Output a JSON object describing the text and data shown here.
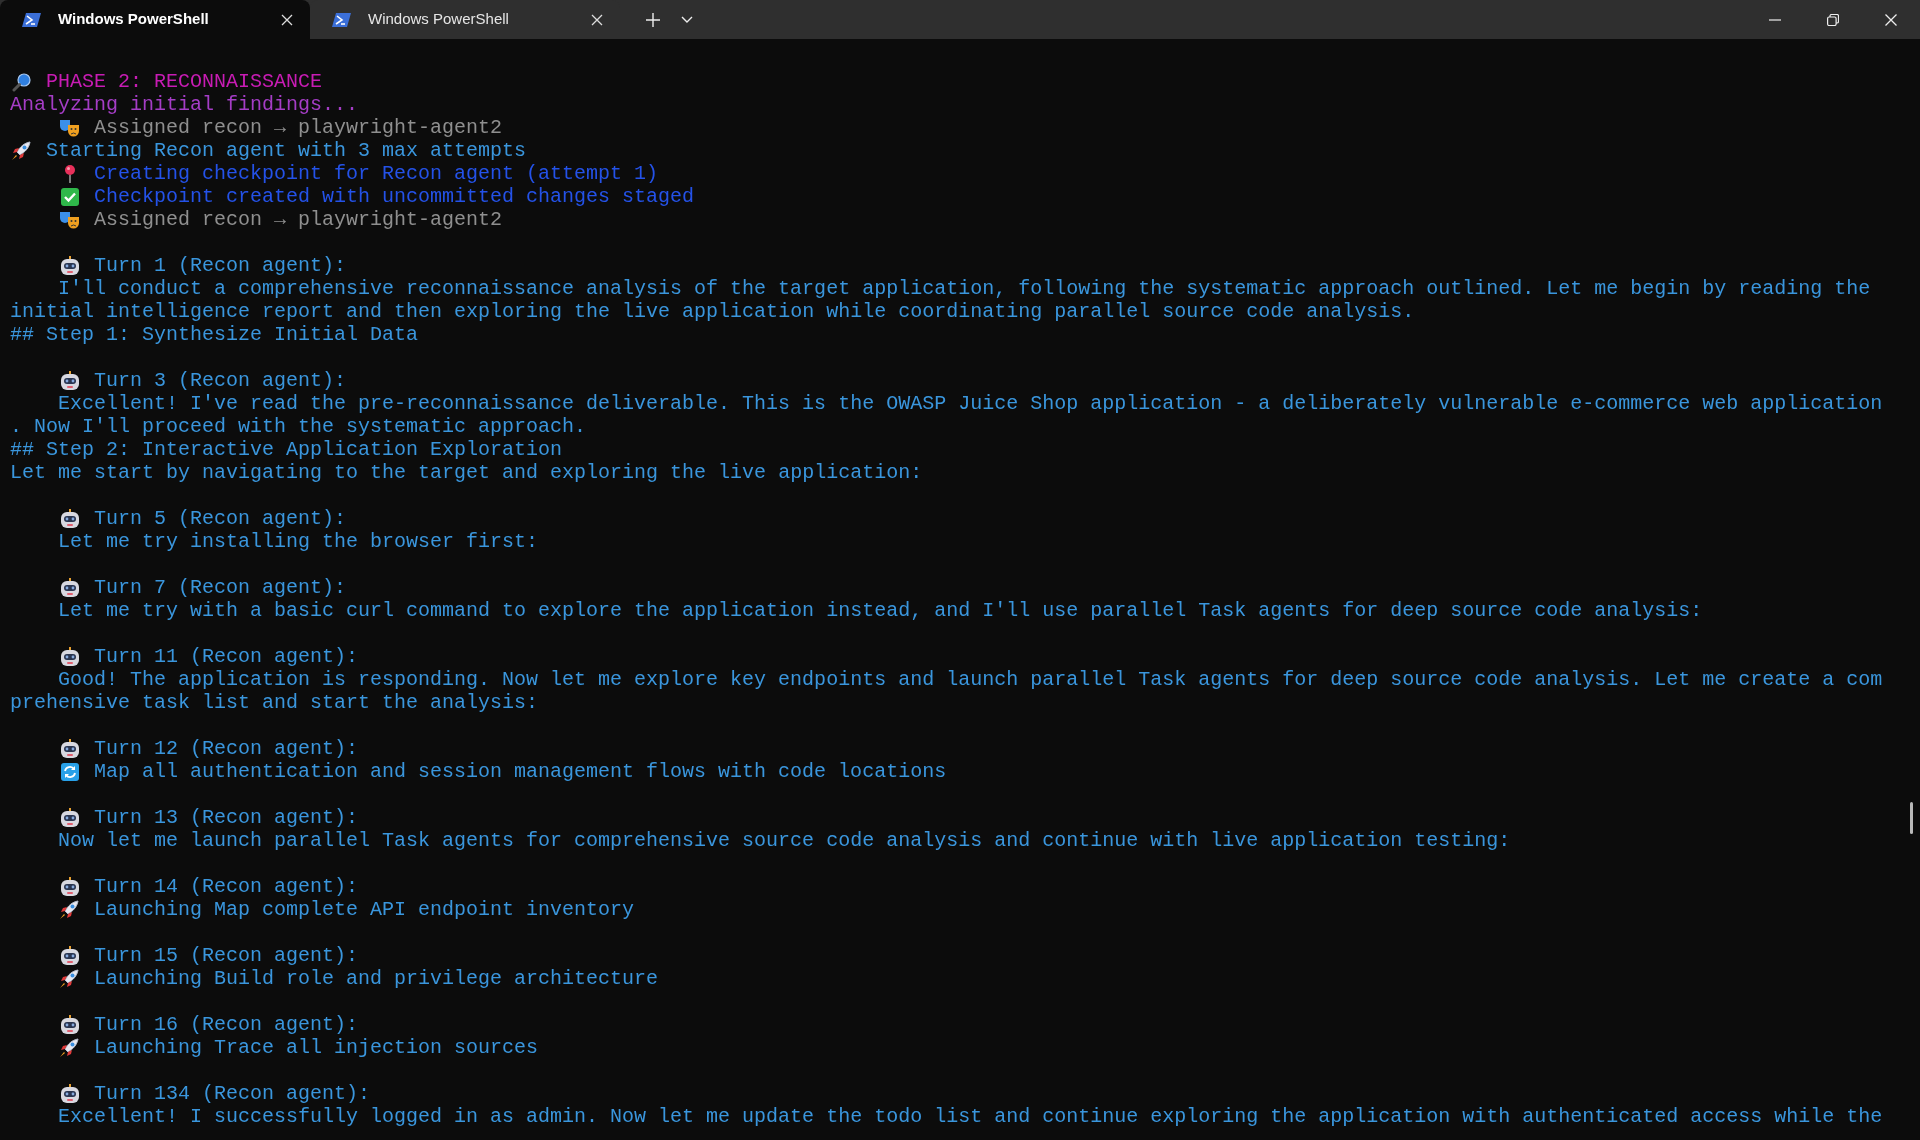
{
  "tabs": [
    {
      "title": "Windows PowerShell",
      "selected": true
    },
    {
      "title": "Windows PowerShell",
      "selected": false
    }
  ],
  "lines": [
    {
      "kind": "phase",
      "text": "PHASE 2: RECONNAISSANCE"
    },
    {
      "kind": "note",
      "text": "Analyzing initial findings..."
    },
    {
      "kind": "assign",
      "text": "Assigned recon → playwright-agent2"
    },
    {
      "kind": "start",
      "text": "Starting Recon agent with 3 max attempts"
    },
    {
      "kind": "pin",
      "text": "Creating checkpoint for Recon agent (attempt 1)"
    },
    {
      "kind": "check",
      "text": "Checkpoint created with uncommitted changes staged"
    },
    {
      "kind": "assign",
      "text": "Assigned recon → playwright-agent2"
    },
    {
      "kind": "blank"
    },
    {
      "kind": "turn",
      "text": "Turn 1 (Recon agent):"
    },
    {
      "kind": "body",
      "text": "I'll conduct a comprehensive reconnaissance analysis of the target application, following the systematic approach outlined. Let me begin by reading the"
    },
    {
      "kind": "wrap",
      "text": "initial intelligence report and then exploring the live application while coordinating parallel source code analysis."
    },
    {
      "kind": "wrap",
      "text": "## Step 1: Synthesize Initial Data"
    },
    {
      "kind": "blank"
    },
    {
      "kind": "turn",
      "text": "Turn 3 (Recon agent):"
    },
    {
      "kind": "body",
      "text": "Excellent! I've read the pre-reconnaissance deliverable. This is the OWASP Juice Shop application - a deliberately vulnerable e-commerce web application"
    },
    {
      "kind": "wrap",
      "text": ". Now I'll proceed with the systematic approach."
    },
    {
      "kind": "wrap",
      "text": "## Step 2: Interactive Application Exploration"
    },
    {
      "kind": "wrap",
      "text": "Let me start by navigating to the target and exploring the live application:"
    },
    {
      "kind": "blank"
    },
    {
      "kind": "turn",
      "text": "Turn 5 (Recon agent):"
    },
    {
      "kind": "body",
      "text": "Let me try installing the browser first:"
    },
    {
      "kind": "blank"
    },
    {
      "kind": "turn",
      "text": "Turn 7 (Recon agent):"
    },
    {
      "kind": "body",
      "text": "Let me try with a basic curl command to explore the application instead, and I'll use parallel Task agents for deep source code analysis:"
    },
    {
      "kind": "blank"
    },
    {
      "kind": "turn",
      "text": "Turn 11 (Recon agent):"
    },
    {
      "kind": "body",
      "text": "Good! The application is responding. Now let me explore key endpoints and launch parallel Task agents for deep source code analysis. Let me create a com"
    },
    {
      "kind": "wrap",
      "text": "prehensive task list and start the analysis:"
    },
    {
      "kind": "blank"
    },
    {
      "kind": "turn",
      "text": "Turn 12 (Recon agent):"
    },
    {
      "kind": "task",
      "text": "Map all authentication and session management flows with code locations"
    },
    {
      "kind": "blank"
    },
    {
      "kind": "turn",
      "text": "Turn 13 (Recon agent):"
    },
    {
      "kind": "body",
      "text": "Now let me launch parallel Task agents for comprehensive source code analysis and continue with live application testing:"
    },
    {
      "kind": "blank"
    },
    {
      "kind": "turn",
      "text": "Turn 14 (Recon agent):"
    },
    {
      "kind": "launch",
      "text": "Launching Map complete API endpoint inventory"
    },
    {
      "kind": "blank"
    },
    {
      "kind": "turn",
      "text": "Turn 15 (Recon agent):"
    },
    {
      "kind": "launch",
      "text": "Launching Build role and privilege architecture"
    },
    {
      "kind": "blank"
    },
    {
      "kind": "turn",
      "text": "Turn 16 (Recon agent):"
    },
    {
      "kind": "launch",
      "text": "Launching Trace all injection sources"
    },
    {
      "kind": "blank"
    },
    {
      "kind": "turn",
      "text": "Turn 134 (Recon agent):"
    },
    {
      "kind": "body",
      "text": "Excellent! I successfully logged in as admin. Now let me update the todo list and continue exploring the application with authenticated access while the"
    }
  ]
}
